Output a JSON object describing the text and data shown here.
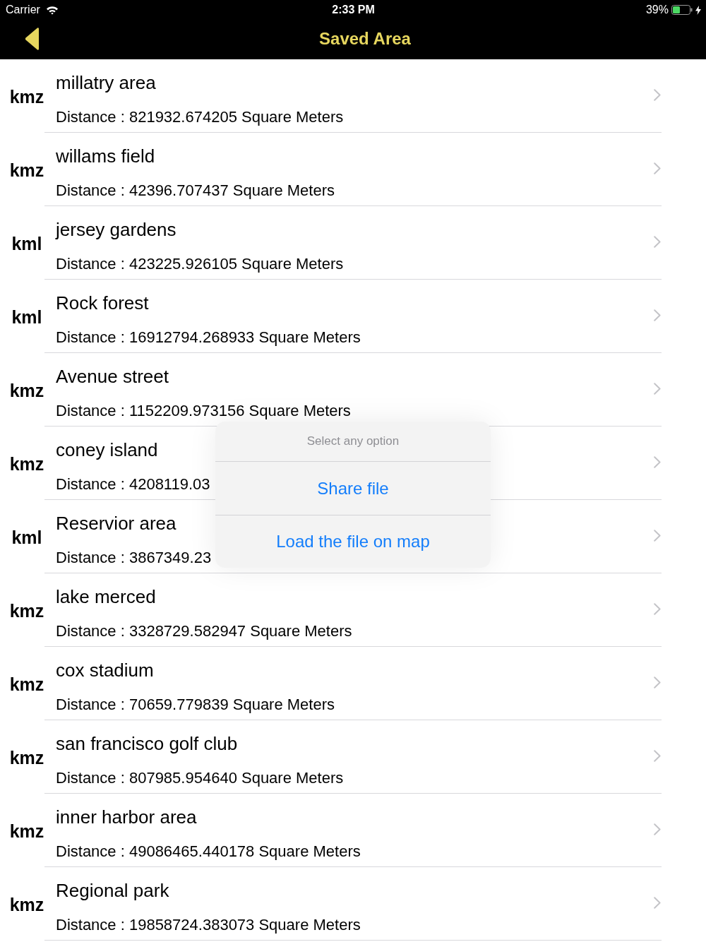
{
  "status_bar": {
    "carrier": "Carrier",
    "time": "2:33 PM",
    "battery": "39%"
  },
  "nav_bar": {
    "title": "Saved Area"
  },
  "files": [
    {
      "type": "kmz",
      "name": "millatry area",
      "area": "Distance : 821932.674205 Square Meters"
    },
    {
      "type": "kmz",
      "name": "willams field",
      "area": "Distance : 42396.707437 Square Meters"
    },
    {
      "type": "kml",
      "name": "jersey gardens",
      "area": "Distance : 423225.926105 Square Meters"
    },
    {
      "type": "kml",
      "name": "Rock forest",
      "area": "Distance : 16912794.268933 Square Meters"
    },
    {
      "type": "kmz",
      "name": "Avenue street",
      "area": "Distance : 1152209.973156 Square Meters"
    },
    {
      "type": "kmz",
      "name": "coney island",
      "area": "Distance : 4208119.03"
    },
    {
      "type": "kml",
      "name": "Reservior area",
      "area": "Distance : 3867349.23"
    },
    {
      "type": "kmz",
      "name": "lake merced",
      "area": "Distance : 3328729.582947 Square Meters"
    },
    {
      "type": "kmz",
      "name": "cox stadium",
      "area": "Distance : 70659.779839 Square Meters"
    },
    {
      "type": "kmz",
      "name": "san francisco golf club",
      "area": "Distance : 807985.954640 Square Meters"
    },
    {
      "type": "kmz",
      "name": "inner harbor area",
      "area": "Distance : 49086465.440178 Square Meters"
    },
    {
      "type": "kmz",
      "name": "Regional park",
      "area": "Distance : 19858724.383073 Square Meters"
    }
  ],
  "action_sheet": {
    "title": "Select any option",
    "actions": [
      "Share file",
      "Load the file on map"
    ]
  }
}
